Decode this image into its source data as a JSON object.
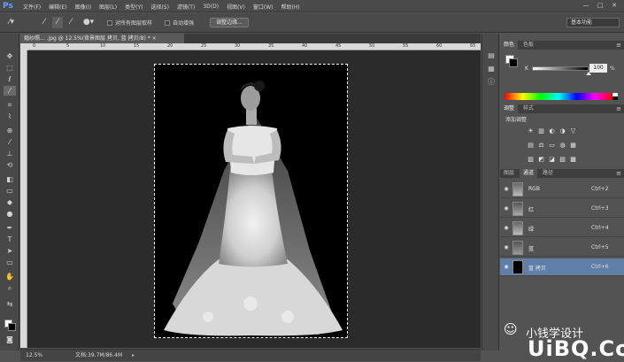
{
  "app": {
    "logo": "Ps"
  },
  "menu": [
    "文件(F)",
    "编辑(E)",
    "图像(I)",
    "图层(L)",
    "类型(Y)",
    "选择(S)",
    "滤镜(T)",
    "3D(D)",
    "视图(V)",
    "窗口(W)",
    "帮助(H)"
  ],
  "window_controls": [
    "—",
    "□",
    "✕"
  ],
  "options": {
    "sample_all_layers": "对所有图层取样",
    "auto_enhance": "自动增强",
    "refine_edge": "调整边缘...",
    "workspace": "基本功能"
  },
  "document": {
    "tab": "婚纱照... .jpg @ 12.5%(背景图层 拷贝, 蓝 拷贝/8) * ×",
    "ruler_h": [
      "0",
      "5",
      "10",
      "15",
      "20",
      "25",
      "30",
      "35",
      "40",
      "45",
      "50",
      "55",
      "60",
      "65"
    ],
    "zoom": "12.5%",
    "doc_info": "文档:39.7M/86.4M"
  },
  "colors": {
    "accent": "#5f7ea8",
    "panel_bg": "#535353",
    "canvas_bg": "#2b2b2b",
    "spectrum_colors": [
      "#ff0000",
      "#ffff00",
      "#00ff00",
      "#00ffff",
      "#0000ff",
      "#ff00ff"
    ],
    "red_channel": "#8a3a3a",
    "green_channel": "#3a7a3a",
    "blue_channel": "#3a4a8a"
  },
  "color_panel": {
    "tabs": [
      "颜色",
      "色板"
    ],
    "k_label": "K",
    "k_value": "100",
    "k_unit": "%",
    "k_level": 1.0
  },
  "adjustments_panel": {
    "tabs": [
      "调整",
      "样式"
    ],
    "title": "添加调整",
    "icons": [
      "☀",
      "▥",
      "◐",
      "◑",
      "▽",
      "▤",
      "⚖",
      "▭",
      "◍",
      "▦",
      "▨",
      "◩",
      "◪",
      "▧",
      "▩"
    ]
  },
  "channels_panel": {
    "tabs": [
      "图层",
      "通道",
      "路径"
    ],
    "rows": [
      {
        "name": "RGB",
        "shortcut": "Ctrl+2",
        "visible": true,
        "selected": false
      },
      {
        "name": "红",
        "shortcut": "Ctrl+3",
        "visible": true,
        "selected": false
      },
      {
        "name": "绿",
        "shortcut": "Ctrl+4",
        "visible": true,
        "selected": false
      },
      {
        "name": "蓝",
        "shortcut": "Ctrl+5",
        "visible": true,
        "selected": false
      },
      {
        "name": "蓝 拷贝",
        "shortcut": "Ctrl+6",
        "visible": true,
        "selected": true
      }
    ]
  },
  "watermark": {
    "author": "小钱学设计",
    "site": "UiBQ.CoM"
  }
}
